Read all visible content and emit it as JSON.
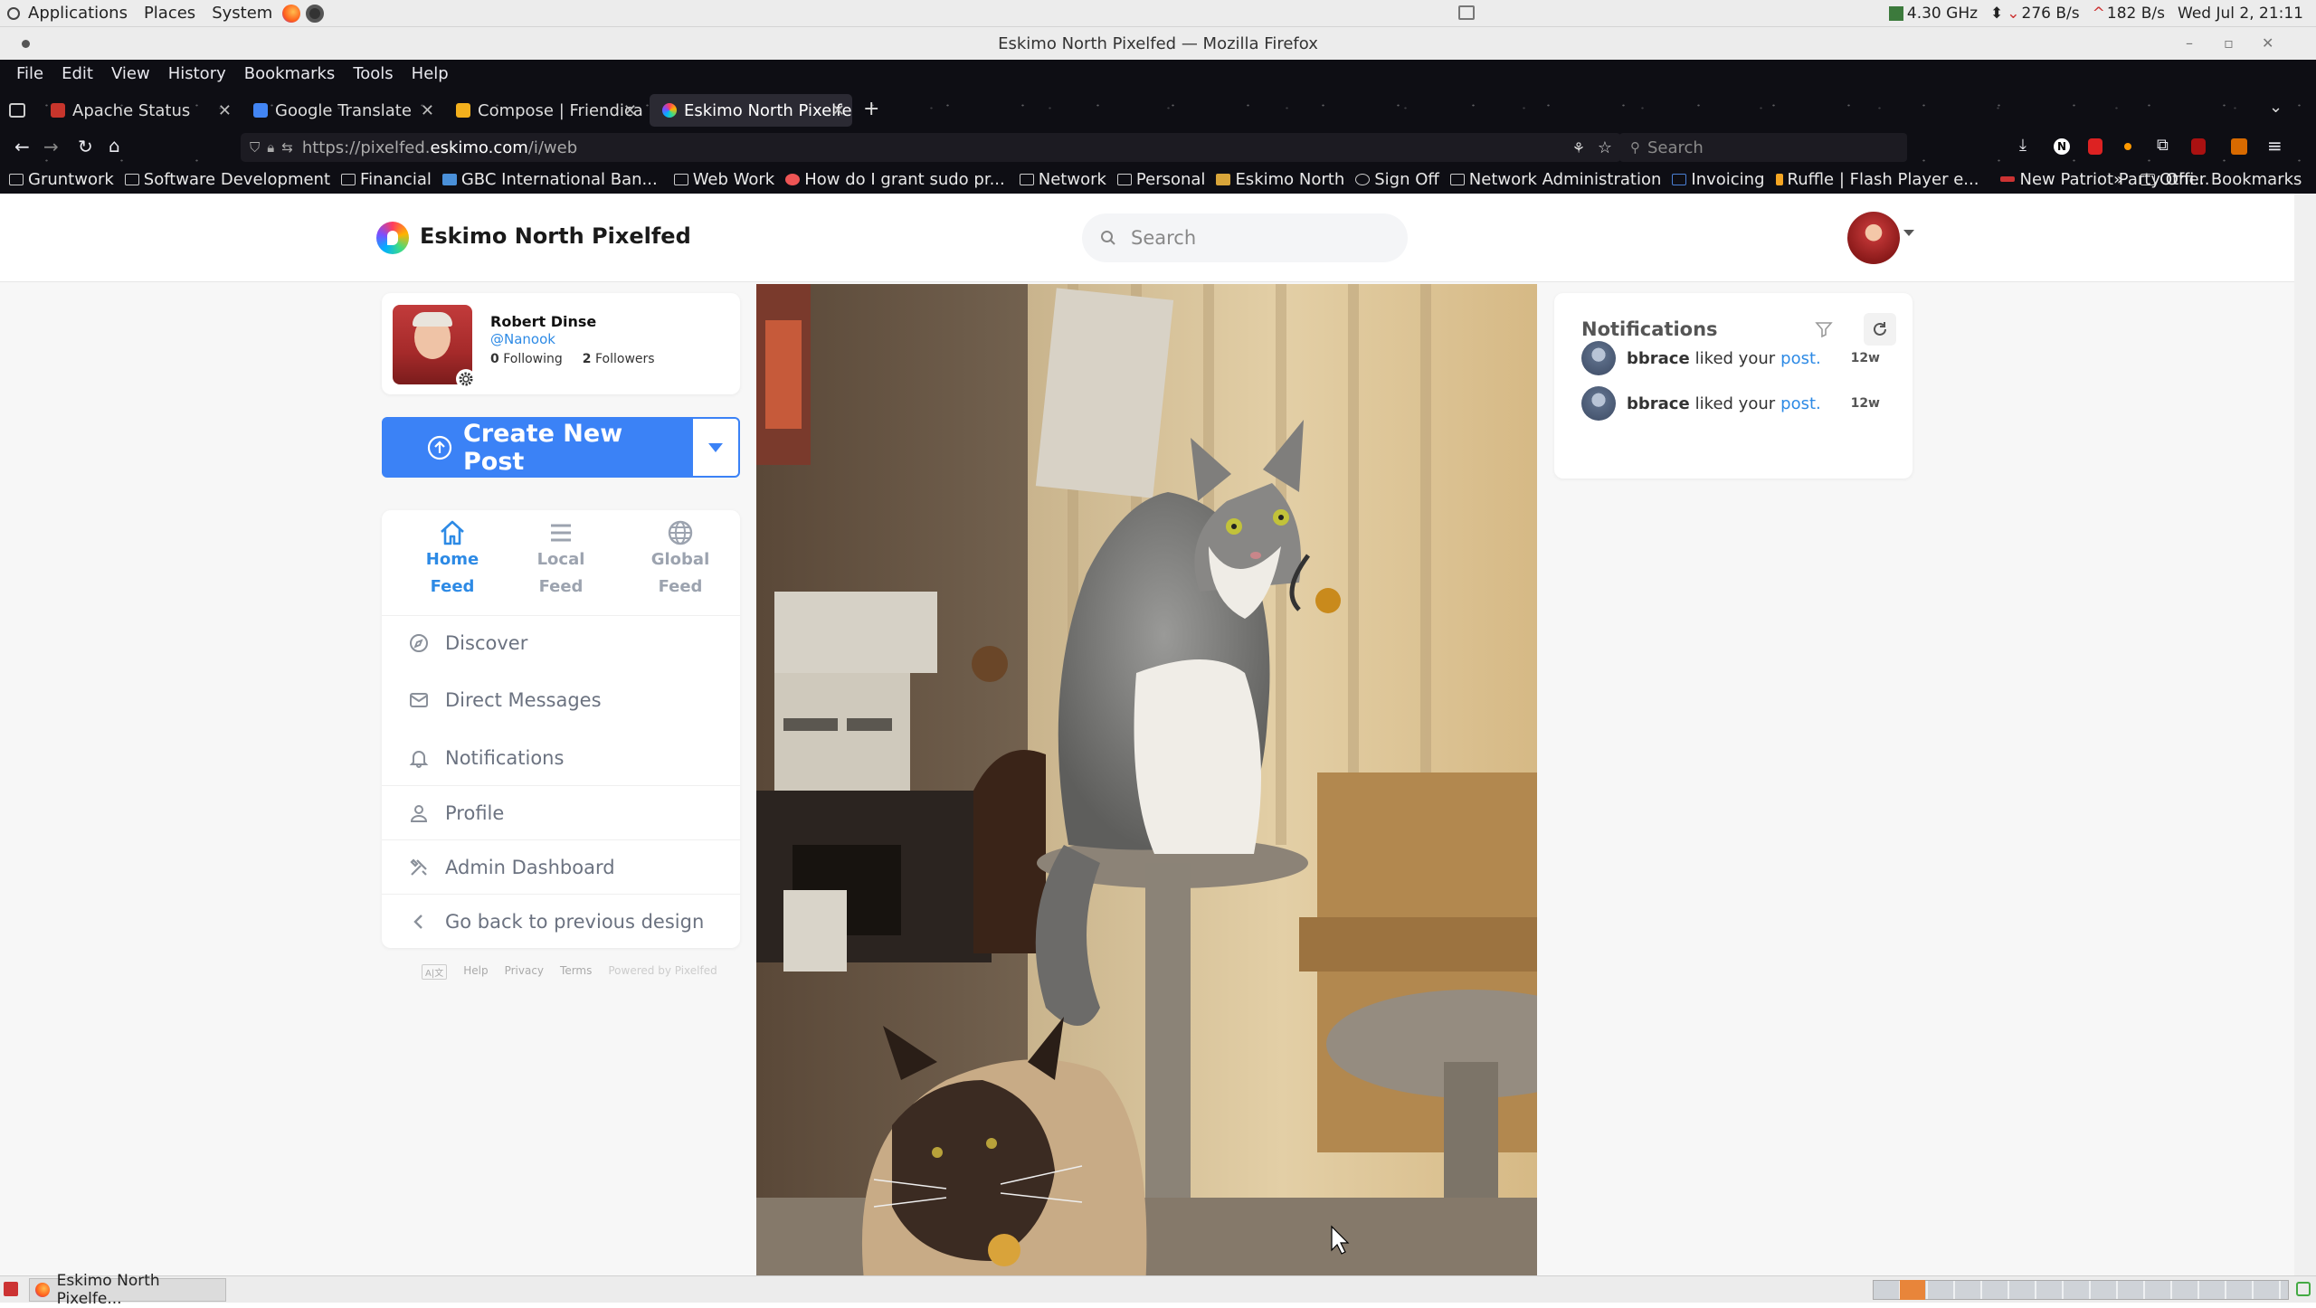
{
  "os_panel": {
    "menus": [
      "Applications",
      "Places",
      "System"
    ],
    "cpu": "4.30 GHz",
    "net_down": "276 B/s",
    "net_up": "182 B/s",
    "clock": "Wed Jul  2, 21:11"
  },
  "window": {
    "title": "Eskimo North Pixelfed — Mozilla Firefox"
  },
  "browser": {
    "menu": [
      "File",
      "Edit",
      "View",
      "History",
      "Bookmarks",
      "Tools",
      "Help"
    ],
    "tabs": [
      {
        "label": "Apache Status",
        "active": false
      },
      {
        "label": "Google Translate",
        "active": false
      },
      {
        "label": "Compose | Friendica",
        "active": false
      },
      {
        "label": "Eskimo North Pixelfe",
        "active": true
      }
    ],
    "url_prefix": "https://pixelfed.",
    "url_host": "eskimo.com",
    "url_path": "/i/web",
    "search_placeholder": "Search",
    "bookmarks": [
      "Gruntwork",
      "Software Development",
      "Financial",
      "GBC International Ban...",
      "Web Work",
      "How do I grant sudo pr...",
      "Network",
      "Personal",
      "Eskimo North",
      "Sign Off",
      "Network Administration",
      "Invoicing",
      "Ruffle | Flash Player e...",
      "New Patriot Party Offi..."
    ],
    "other_bookmarks": "Other Bookmarks"
  },
  "site": {
    "brand": "Eskimo North Pixelfed",
    "search_placeholder": "Search"
  },
  "profile": {
    "name": "Robert Dinse",
    "handle": "@Nanook",
    "following_count": "0",
    "following_label": "Following",
    "followers_count": "2",
    "followers_label": "Followers"
  },
  "create": {
    "label": "Create New Post"
  },
  "feeds": [
    {
      "line1": "Home",
      "line2": "Feed",
      "active": true
    },
    {
      "line1": "Local",
      "line2": "Feed",
      "active": false
    },
    {
      "line1": "Global",
      "line2": "Feed",
      "active": false
    }
  ],
  "nav": {
    "discover": "Discover",
    "messages": "Direct Messages",
    "notifications": "Notifications",
    "profile": "Profile",
    "admin": "Admin Dashboard",
    "back": "Go back to previous design"
  },
  "footer": {
    "lang": "A|文",
    "help": "Help",
    "privacy": "Privacy",
    "terms": "Terms",
    "powered": "Powered by Pixelfed"
  },
  "notifications": {
    "title": "Notifications",
    "items": [
      {
        "user": "bbrace",
        "text": "liked your",
        "link": "post.",
        "age": "12w"
      },
      {
        "user": "bbrace",
        "text": "liked your",
        "link": "post.",
        "age": "12w"
      }
    ]
  },
  "taskbar": {
    "window": "Eskimo North Pixelfe..."
  },
  "colors": {
    "accent": "#3b82f6",
    "link": "#2d8ae5",
    "chrome": "#0e0e14"
  }
}
